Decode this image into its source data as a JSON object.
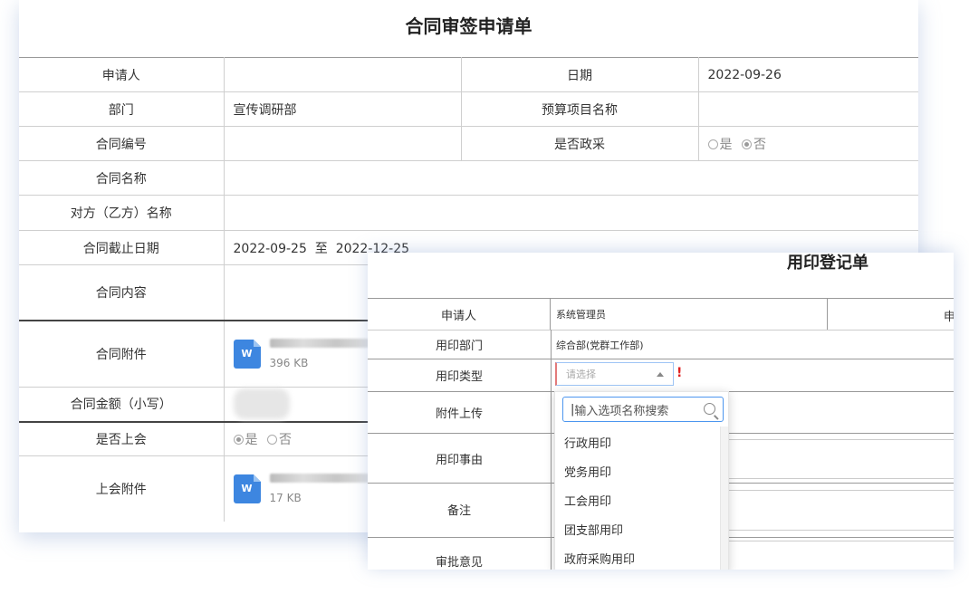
{
  "contract_form": {
    "title": "合同审签申请单",
    "applicant_label": "申请人",
    "applicant_value": "",
    "date_label": "日期",
    "date_value": "2022-09-26",
    "dept_label": "部门",
    "dept_value": "宣传调研部",
    "budget_label": "预算项目名称",
    "contract_no_label": "合同编号",
    "gov_purchase_label": "是否政采",
    "gov_purchase_options": [
      "是",
      "否"
    ],
    "gov_purchase_selected": "否",
    "contract_name_label": "合同名称",
    "counterparty_label": "对方（乙方）名称",
    "deadline_label": "合同截止日期",
    "deadline_start": "2022-09-25",
    "deadline_to": "至",
    "deadline_end": "2022-12-25",
    "content_label": "合同内容",
    "attachment_label": "合同附件",
    "attachment_size": "396 KB",
    "amount_label": "合同金额（小写）",
    "meeting_label": "是否上会",
    "meeting_options": [
      "是",
      "否"
    ],
    "meeting_selected": "是",
    "meeting_attachment_label": "上会附件",
    "meeting_attachment_size": "17 KB",
    "file_icon_letter": "W"
  },
  "seal_form": {
    "title": "用印登记单",
    "applicant_label": "申请人",
    "applicant_value": "系统管理员",
    "applicant_extra": "申",
    "seal_dept_label": "用印部门",
    "seal_dept_value": "综合部(党群工作部)",
    "seal_type_label": "用印类型",
    "seal_type_placeholder": "请选择",
    "required_mark": "!",
    "upload_label": "附件上传",
    "reason_label": "用印事由",
    "remark_label": "备注",
    "approval_label": "审批意见",
    "dropdown": {
      "search_placeholder": "输入选项名称搜索",
      "options": [
        "行政用印",
        "党务用印",
        "工会用印",
        "团支部用印",
        "政府采购用印"
      ]
    }
  }
}
